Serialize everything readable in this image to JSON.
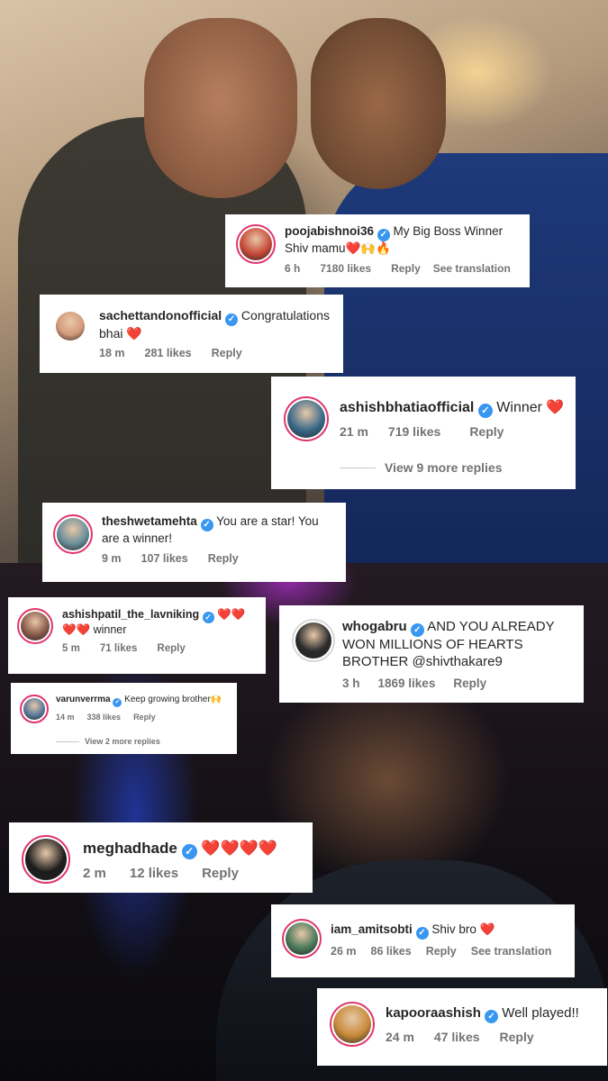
{
  "comments": [
    {
      "username": "poojabishnoi36",
      "verified_mark": "✓",
      "text": "My Big Boss Winner Shiv mamu❤️🙌🔥",
      "time": "6 h",
      "likes": "7180 likes",
      "reply": "Reply",
      "translation": "See translation",
      "avatar_color": "#c84a3a"
    },
    {
      "username": "sachettandonofficial",
      "verified_mark": "✓",
      "text": "Congratulations bhai ❤️",
      "time": "18 m",
      "likes": "281 likes",
      "reply": "Reply",
      "avatar_color": "#d39a7a"
    },
    {
      "username": "ashishbhatiaofficial",
      "verified_mark": "✓",
      "text": "Winner ❤️",
      "time": "21 m",
      "likes": "719 likes",
      "reply": "Reply",
      "more_replies": "View 9 more replies",
      "avatar_color": "#3b6a8a"
    },
    {
      "username": "theshwetamehta",
      "verified_mark": "✓",
      "text": "You are a star! You are a winner!",
      "time": "9 m",
      "likes": "107 likes",
      "reply": "Reply",
      "avatar_color": "#6a8f9a"
    },
    {
      "username": "ashishpatil_the_lavniking",
      "verified_mark": "✓",
      "text": "❤️❤️❤️❤️ winner",
      "time": "5 m",
      "likes": "71 likes",
      "reply": "Reply",
      "avatar_color": "#8a5a4a"
    },
    {
      "username": "whogabru",
      "verified_mark": "✓",
      "text": "AND YOU ALREADY WON MILLIONS OF HEARTS BROTHER @shivthakare9",
      "time": "3 h",
      "likes": "1869 likes",
      "reply": "Reply",
      "avatar_color": "#2a2a2a"
    },
    {
      "username": "varunverrma",
      "verified_mark": "✓",
      "text": "Keep growing brother🙌",
      "time": "14 m",
      "likes": "338 likes",
      "reply": "Reply",
      "more_replies": "View 2 more replies",
      "avatar_color": "#5a7a9a"
    },
    {
      "username": "meghadhade",
      "verified_mark": "✓",
      "text": "❤️❤️❤️❤️",
      "time": "2 m",
      "likes": "12 likes",
      "reply": "Reply",
      "avatar_color": "#1c1c1c"
    },
    {
      "username": "iam_amitsobti",
      "verified_mark": "✓",
      "text": "Shiv bro ❤️",
      "time": "26 m",
      "likes": "86 likes",
      "reply": "Reply",
      "translation": "See translation",
      "avatar_color": "#4a7a5a"
    },
    {
      "username": "kapooraashish",
      "verified_mark": "✓",
      "text": "Well played!!",
      "time": "24 m",
      "likes": "47 likes",
      "reply": "Reply",
      "avatar_color": "#c88a3a"
    }
  ]
}
